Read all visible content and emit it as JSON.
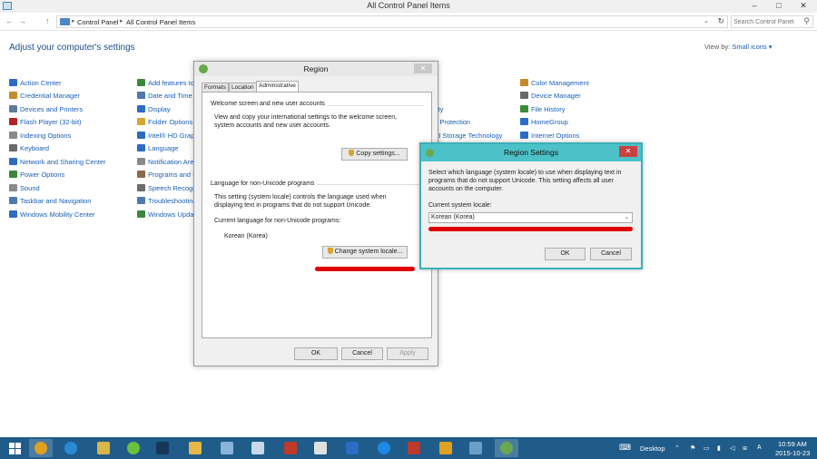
{
  "window": {
    "title": "All Control Panel Items",
    "minimize": "–",
    "maximize": "□",
    "close": "✕"
  },
  "nav": {
    "back": "←",
    "forward": "→",
    "up": "↑",
    "breadcrumb": [
      "Control Panel",
      "All Control Panel Items"
    ],
    "separator": "▸",
    "search_placeholder": "Search Control Panel"
  },
  "heading": "Adjust your computer's settings",
  "view_by": {
    "label": "View by:",
    "value": "Small icons ▾"
  },
  "items": {
    "col1": [
      {
        "label": "Action Center",
        "color": "#2b6cc4"
      },
      {
        "label": "Credential Manager",
        "color": "#c58b2a"
      },
      {
        "label": "Devices and Printers",
        "color": "#5a7a9a"
      },
      {
        "label": "Flash Player (32-bit)",
        "color": "#b22222"
      },
      {
        "label": "Indexing Options",
        "color": "#8a8a8a"
      },
      {
        "label": "Keyboard",
        "color": "#6a6a6a"
      },
      {
        "label": "Network and Sharing Center",
        "color": "#2b6cc4"
      },
      {
        "label": "Power Options",
        "color": "#3a8a3a"
      },
      {
        "label": "Sound",
        "color": "#8a8a8a"
      },
      {
        "label": "Taskbar and Navigation",
        "color": "#4a7ab0"
      },
      {
        "label": "Windows Mobility Center",
        "color": "#2b6cc4"
      }
    ],
    "col2": [
      {
        "label": "Add features to",
        "color": "#3a8a3a"
      },
      {
        "label": "Date and Time",
        "color": "#4a7ab0"
      },
      {
        "label": "Display",
        "color": "#2b6cc4"
      },
      {
        "label": "Folder Options",
        "color": "#d9a531"
      },
      {
        "label": "Intel® HD Graph",
        "color": "#2b6cc4"
      },
      {
        "label": "Language",
        "color": "#2b6cc4"
      },
      {
        "label": "Notification Area",
        "color": "#8a8a8a"
      },
      {
        "label": "Programs and Fe",
        "color": "#8a6a4a"
      },
      {
        "label": "Speech Recogni",
        "color": "#6a6a6a"
      },
      {
        "label": "Troubleshooting",
        "color": "#4a7ab0"
      },
      {
        "label": "Windows Updat",
        "color": "#3a8a3a"
      }
    ],
    "col3": [
      {
        "label": "ity"
      },
      {
        "label": "ta Protection"
      },
      {
        "label": "d Storage Technology"
      }
    ],
    "col4": [
      {
        "label": "Color Management",
        "color": "#c58b2a"
      },
      {
        "label": "Device Manager",
        "color": "#6a6a6a"
      },
      {
        "label": "File History",
        "color": "#3a8a3a"
      },
      {
        "label": "HomeGroup",
        "color": "#2b6cc4"
      },
      {
        "label": "Internet Options",
        "color": "#2b6cc4"
      }
    ]
  },
  "region_dialog": {
    "title": "Region",
    "close": "✕",
    "tabs": [
      "Formats",
      "Location",
      "Administrative"
    ],
    "welcome_group": "Welcome screen and new user accounts",
    "welcome_text_1": "View and copy your international settings to the welcome screen,",
    "welcome_text_2": "system accounts and new user accounts.",
    "copy_button": "Copy settings...",
    "unicode_group": "Language for non-Unicode programs",
    "unicode_text_1": "This setting (system locale) controls the language used when",
    "unicode_text_2": "displaying text in programs that do not support Unicode.",
    "current_label": "Current language for non-Unicode programs:",
    "current_value": "Korean (Korea)",
    "change_button": "Change system locale...",
    "ok": "OK",
    "cancel": "Cancel",
    "apply": "Apply"
  },
  "region_settings": {
    "title": "Region Settings",
    "close": "✕",
    "text_1": "Select which language (system locale) to use when displaying text in",
    "text_2": "programs that do not support Unicode. This setting affects all user",
    "text_3": "accounts on the computer.",
    "locale_label": "Current system locale:",
    "locale_value": "Korean (Korea)",
    "ok": "OK",
    "cancel": "Cancel"
  },
  "taskbar": {
    "apps": [
      {
        "name": "chrome",
        "color": "#e0a020"
      },
      {
        "name": "internet-explorer",
        "color": "#2b8ad4"
      },
      {
        "name": "file-explorer",
        "color": "#d9b54a"
      },
      {
        "name": "dreamweaver",
        "color": "#6cbf3a"
      },
      {
        "name": "photoshop",
        "color": "#16375a"
      },
      {
        "name": "outlook",
        "color": "#e6b84a"
      },
      {
        "name": "notepad",
        "color": "#8ab4d8"
      },
      {
        "name": "word-doc",
        "color": "#c8d8e8"
      },
      {
        "name": "filezilla",
        "color": "#c0392b"
      },
      {
        "name": "people",
        "color": "#e0e0e0"
      },
      {
        "name": "remote-desktop",
        "color": "#2b6cc4"
      },
      {
        "name": "teamviewer",
        "color": "#1e88e5"
      },
      {
        "name": "vnc",
        "color": "#c0392b"
      },
      {
        "name": "tool",
        "color": "#e0a020"
      },
      {
        "name": "network",
        "color": "#6aa0c8"
      },
      {
        "name": "control-panel",
        "color": "#6aa84f"
      }
    ],
    "desktop_label": "Desktop",
    "time": "10:59 AM",
    "date": "2015-10-23"
  }
}
